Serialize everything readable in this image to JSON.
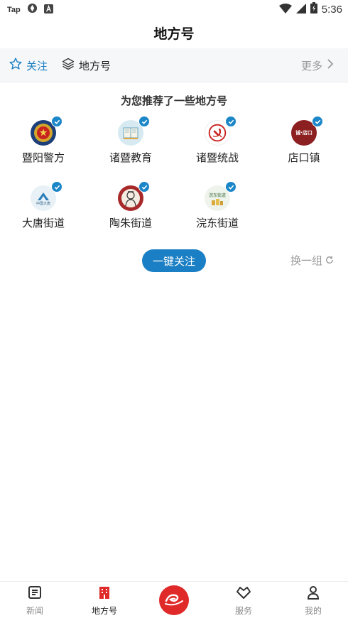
{
  "status_bar": {
    "carrier": "Tap",
    "time": "5:36"
  },
  "header": {
    "title": "地方号"
  },
  "tabs": {
    "follow_label": "关注",
    "local_label": "地方号",
    "more_label": "更多"
  },
  "recommend": {
    "heading": "为您推荐了一些地方号",
    "items": [
      {
        "name": "暨阳警方",
        "icon": "police-emblem"
      },
      {
        "name": "诸暨教育",
        "icon": "book"
      },
      {
        "name": "诸暨统战",
        "icon": "party-emblem"
      },
      {
        "name": "店口镇",
        "icon": "town-logo",
        "logo_text": "诚·店口"
      },
      {
        "name": "大唐街道",
        "icon": "datang-logo",
        "logo_text": "中国大唐"
      },
      {
        "name": "陶朱街道",
        "icon": "portrait"
      },
      {
        "name": "浣东街道",
        "icon": "huandong-logo",
        "logo_text": "浣东街道"
      }
    ],
    "follow_all_label": "一键关注",
    "refresh_label": "换一组"
  },
  "bottom_nav": {
    "items": [
      {
        "label": "新闻",
        "icon": "news-icon"
      },
      {
        "label": "地方号",
        "icon": "building-icon",
        "active": true
      },
      {
        "label": "",
        "icon": "app-logo"
      },
      {
        "label": "服务",
        "icon": "service-icon"
      },
      {
        "label": "我的",
        "icon": "profile-icon"
      }
    ]
  },
  "colors": {
    "accent": "#1a7fc4",
    "active_red": "#e02a2a",
    "muted": "#9a9a9a"
  }
}
